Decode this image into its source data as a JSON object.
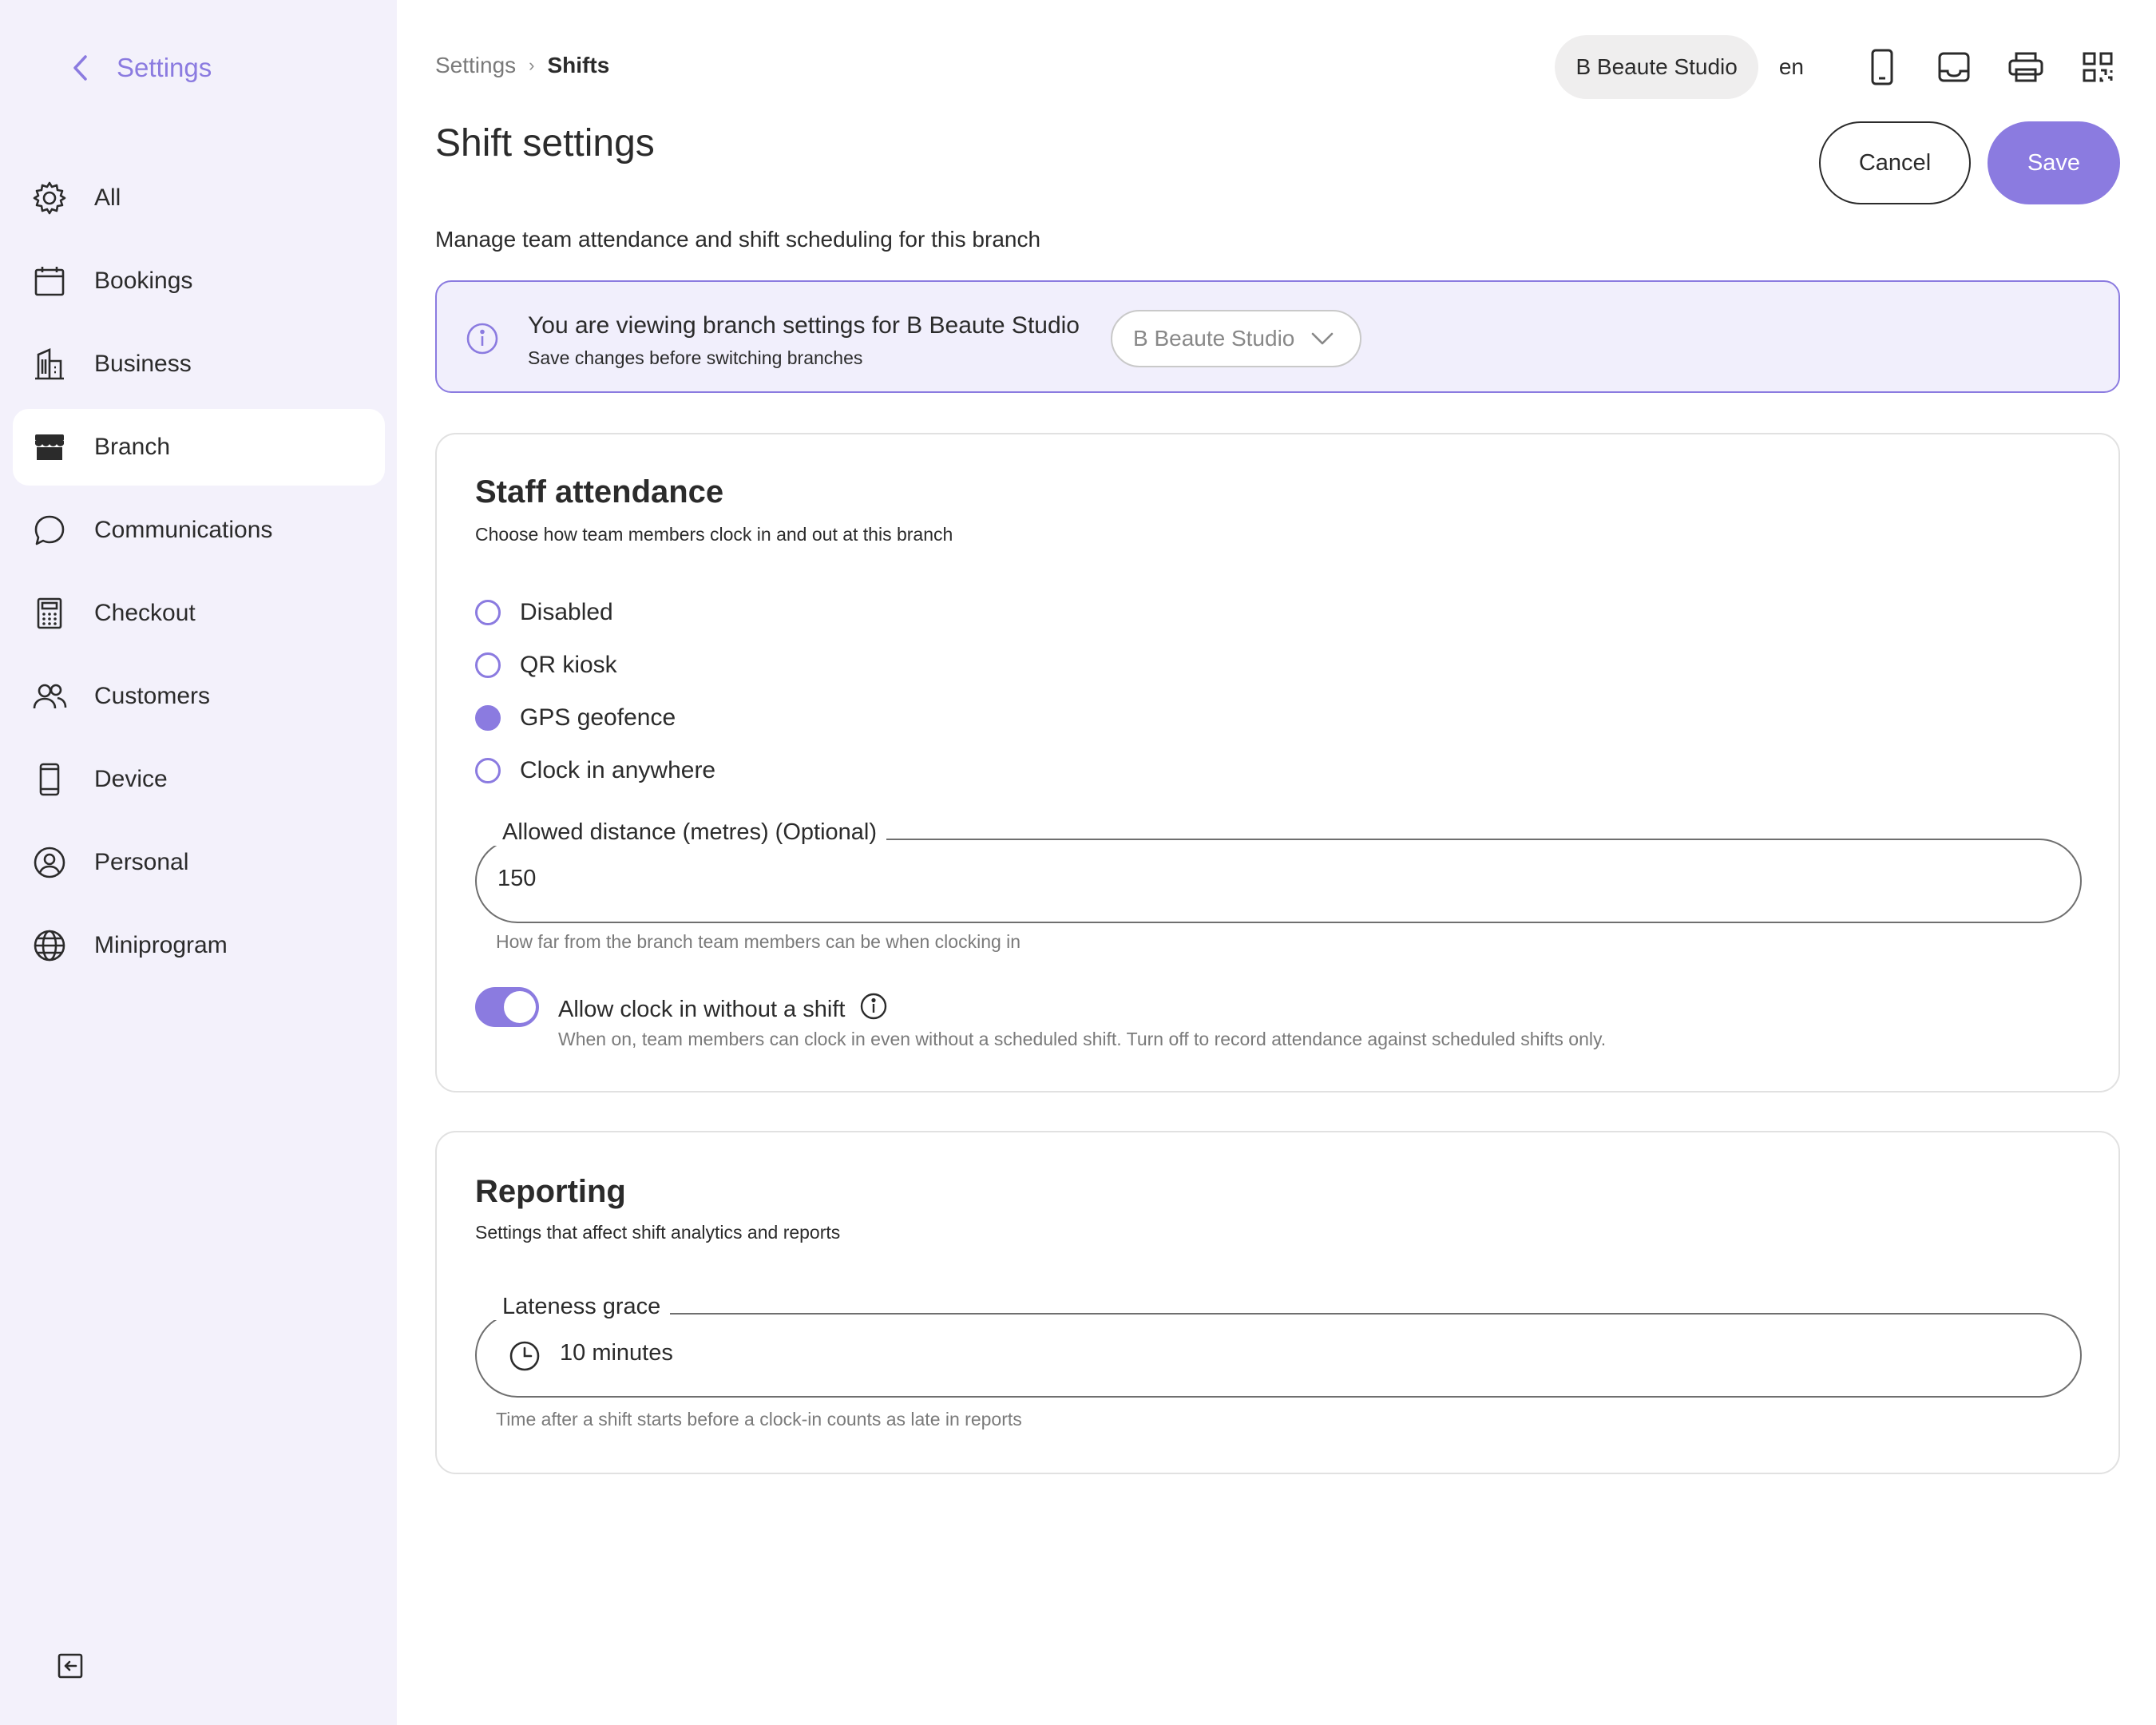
{
  "sidebar": {
    "back_title": "Settings",
    "items": [
      {
        "label": "All",
        "icon": "gear-icon"
      },
      {
        "label": "Bookings",
        "icon": "calendar-icon"
      },
      {
        "label": "Business",
        "icon": "building-icon"
      },
      {
        "label": "Branch",
        "icon": "store-icon",
        "active": true
      },
      {
        "label": "Communications",
        "icon": "chat-bubble-icon"
      },
      {
        "label": "Checkout",
        "icon": "calculator-icon"
      },
      {
        "label": "Customers",
        "icon": "users-icon"
      },
      {
        "label": "Device",
        "icon": "mobile-icon"
      },
      {
        "label": "Personal",
        "icon": "user-circle-icon"
      },
      {
        "label": "Miniprogram",
        "icon": "globe-icon"
      }
    ]
  },
  "breadcrumb": {
    "root": "Settings",
    "sep": "›",
    "current": "Shifts"
  },
  "topbar": {
    "branch": "B Beaute Studio",
    "lang": "en"
  },
  "page": {
    "title": "Shift settings",
    "description": "Manage team attendance and shift scheduling for this branch",
    "cancel_label": "Cancel",
    "save_label": "Save"
  },
  "banner": {
    "line1": "You are viewing branch settings for B Beaute Studio",
    "line2": "Save changes before switching branches",
    "branch_select": "B Beaute Studio"
  },
  "attendance": {
    "title": "Staff attendance",
    "subtitle": "Choose how team members clock in and out at this branch",
    "options": [
      "Disabled",
      "QR kiosk",
      "GPS geofence",
      "Clock in anywhere"
    ],
    "selected": "GPS geofence",
    "distance_label": "Allowed distance (metres) (Optional)",
    "distance_value": "150",
    "distance_help": "How far from the branch team members can be when clocking in",
    "toggle_label": "Allow clock in without a shift",
    "toggle_on": true,
    "toggle_help": "When on, team members can clock in even without a scheduled shift. Turn off to record attendance against scheduled shifts only."
  },
  "reporting": {
    "title": "Reporting",
    "subtitle": "Settings that affect shift analytics and reports",
    "grace_label": "Lateness grace",
    "grace_value": "10 minutes",
    "grace_help": "Time after a shift starts before a clock-in counts as late in reports"
  },
  "colors": {
    "accent": "#8b7be0",
    "sidebar_bg": "#f3f1fb",
    "banner_bg": "#f1effc"
  }
}
